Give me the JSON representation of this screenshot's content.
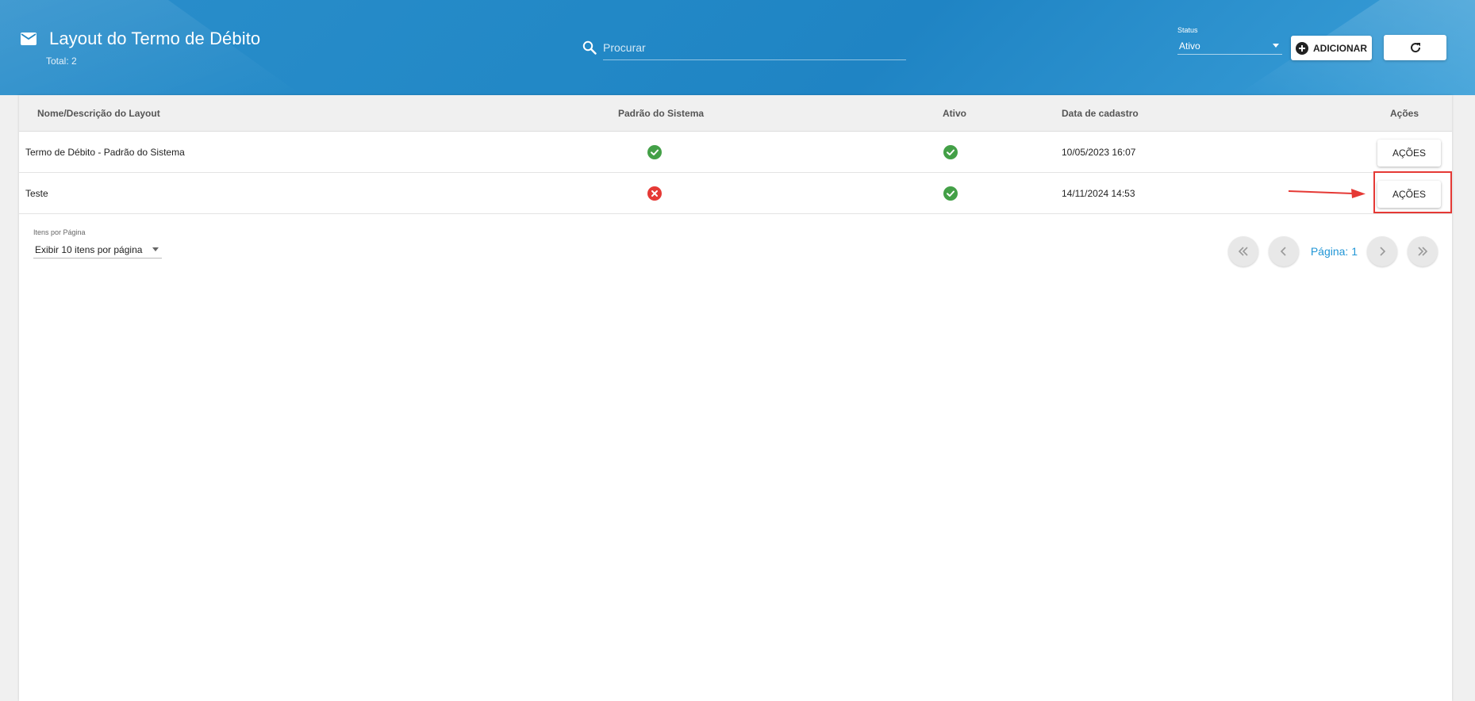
{
  "header": {
    "title": "Layout do Termo de Débito",
    "total": "Total: 2",
    "search_placeholder": "Procurar",
    "status_label": "Status",
    "status_value": "Ativo",
    "add_label": "ADICIONAR"
  },
  "table": {
    "columns": [
      "Nome/Descrição do Layout",
      "Padrão do Sistema",
      "Ativo",
      "Data de cadastro",
      "Ações"
    ],
    "rows": [
      {
        "name": "Termo de Débito - Padrão do Sistema",
        "padrao": "check-circle-icon",
        "ativo": "check-circle-icon",
        "data": "10/05/2023 16:07",
        "acao": "AÇÕES"
      },
      {
        "name": "Teste",
        "padrao": "x-circle-icon",
        "ativo": "check-circle-icon",
        "data": "14/11/2024 14:53",
        "acao": "AÇÕES"
      }
    ]
  },
  "pagination": {
    "per_page_label": "Itens por Página",
    "per_page_value": "Exibir 10 itens por página",
    "page_label": "Página: 1"
  },
  "colors": {
    "header_blue": "#2288c6",
    "check_green": "#43a047",
    "error_red": "#e53935",
    "page_link": "#2196d6"
  }
}
